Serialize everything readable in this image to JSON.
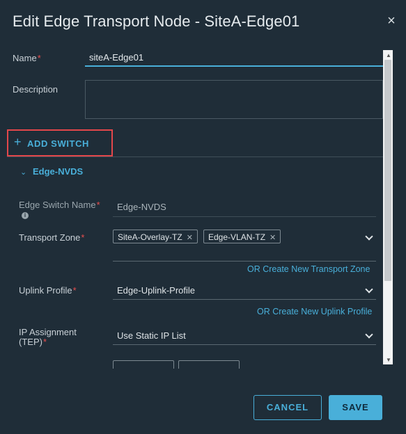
{
  "dialog": {
    "title": "Edit Edge Transport Node - SiteA-Edge01",
    "close_glyph": "×"
  },
  "form": {
    "name_label": "Name",
    "name_value": "siteA-Edge01",
    "description_label": "Description",
    "description_value": "",
    "required_marker": "*"
  },
  "add_switch": {
    "plus": "+",
    "label": "ADD SWITCH"
  },
  "switch_section": {
    "title": "Edge-NVDS",
    "edge_switch_name_label": "Edge Switch Name",
    "edge_switch_name_value": "Edge-NVDS",
    "info_glyph": "i",
    "transport_zone_label": "Transport Zone",
    "transport_zones": [
      "SiteA-Overlay-TZ",
      "Edge-VLAN-TZ"
    ],
    "create_transport_zone_link": "OR Create New Transport Zone",
    "uplink_profile_label": "Uplink Profile",
    "uplink_profile_value": "Edge-Uplink-Profile",
    "create_uplink_profile_link": "OR Create New Uplink Profile",
    "ip_assignment_label_line1": "IP Assignment",
    "ip_assignment_label_line2": "(TEP)",
    "ip_assignment_value": "Use Static IP List"
  },
  "footer": {
    "cancel_label": "CANCEL",
    "save_label": "SAVE"
  },
  "colors": {
    "accent": "#49afd9",
    "required": "#e84e4e",
    "highlight": "#e2474b",
    "background": "#1f2d38"
  }
}
